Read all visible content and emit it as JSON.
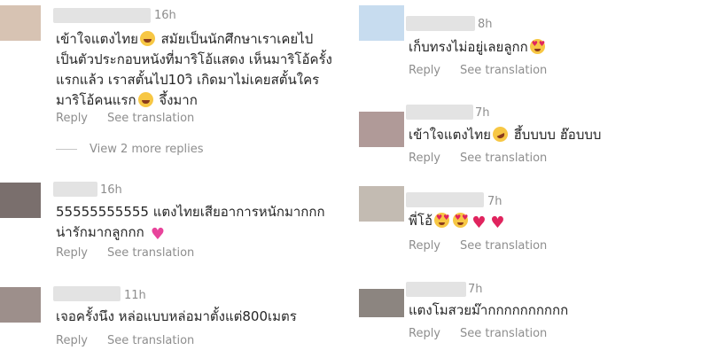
{
  "labels": {
    "reply": "Reply",
    "see_translation": "See translation",
    "view_more_replies": "View 2 more replies"
  },
  "colors": {
    "text": "#262626",
    "secondary": "#8e8e8e",
    "avatar_blurs": [
      "#d7c3b3",
      "#7a6f6d",
      "#9d8f8b",
      "#c7dcef",
      "#b09a98",
      "#c3bbb2",
      "#8c8580"
    ]
  },
  "comments": [
    {
      "time": "16h",
      "lines": [
        "เข้าใจแตงไทย",
        "เป็นตัวประกอบหนังที่มาริโอ้แสดง เห็นมาริโอ้ครั้ง",
        "แรกแล้ว เราสตั้นไป10วิ เกิดมาไม่เคยสตั้นใคร",
        "มาริโอ้คนแรก"
      ],
      "line1_tail": " สมัยเป็นนักศึกษาเราเคยไป",
      "line4_tail": " จึ้งมาก"
    },
    {
      "time": "16h",
      "lines": [
        "55555555555 แตงไทยเสียอาการหนักมากกก",
        "น่ารักมากลูกกก"
      ]
    },
    {
      "time": "11h",
      "lines": [
        "เจอครั้งนึง หล่อแบบหล่อมาตั้งแต่800เมตร"
      ]
    },
    {
      "time": "8h",
      "lines": [
        "เก็บทรงไม่อยู่เลยลูกก"
      ]
    },
    {
      "time": "7h",
      "lines": [
        "เข้าใจแตงไทย",
        " ฮึ้บบบบ ฮ๊อบบบ"
      ]
    },
    {
      "time": "7h",
      "lines": [
        "พี่โอ้"
      ]
    },
    {
      "time": "7h",
      "lines": [
        "แตงโมสวยม๊ากกกกกกกกกก"
      ]
    }
  ]
}
